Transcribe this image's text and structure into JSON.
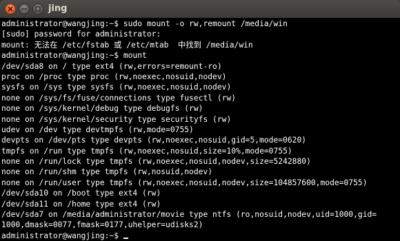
{
  "window": {
    "title": "jing",
    "colors": {
      "terminal_bg": "#000000",
      "terminal_fg": "#ffffff",
      "titlebar_bg": "#3c3b37",
      "close_button": "#e25b27"
    },
    "buttons": {
      "close_icon": "close-icon",
      "minimize_icon": "minimize-icon",
      "maximize_icon": "maximize-icon"
    }
  },
  "terminal": {
    "lines": [
      "administrator@wangjing:~$ sudo mount -o rw,remount /media/win",
      "[sudo] password for administrator:",
      "mount: 无法在 /etc/fstab 或 /etc/mtab  中找到 /media/win",
      "administrator@wangjing:~$ mount",
      "/dev/sda8 on / type ext4 (rw,errors=remount-ro)",
      "proc on /proc type proc (rw,noexec,nosuid,nodev)",
      "sysfs on /sys type sysfs (rw,noexec,nosuid,nodev)",
      "none on /sys/fs/fuse/connections type fusectl (rw)",
      "none on /sys/kernel/debug type debugfs (rw)",
      "none on /sys/kernel/security type securityfs (rw)",
      "udev on /dev type devtmpfs (rw,mode=0755)",
      "devpts on /dev/pts type devpts (rw,noexec,nosuid,gid=5,mode=0620)",
      "tmpfs on /run type tmpfs (rw,noexec,nosuid,size=10%,mode=0755)",
      "none on /run/lock type tmpfs (rw,noexec,nosuid,nodev,size=5242880)",
      "none on /run/shm type tmpfs (rw,nosuid,nodev)",
      "none on /run/user type tmpfs (rw,noexec,nosuid,nodev,size=104857600,mode=0755)",
      "/dev/sda10 on /boot type ext4 (rw)",
      "/dev/sda11 on /home type ext4 (rw)",
      "/dev/sda7 on /media/administrator/movie type ntfs (ro,nosuid,nodev,uid=1000,gid=",
      "1000,dmask=0077,fmask=0177,uhelper=udisks2)"
    ],
    "prompt": "administrator@wangjing:~$ "
  }
}
